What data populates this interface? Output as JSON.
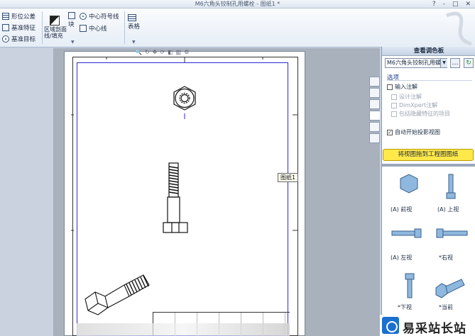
{
  "window": {
    "title": "M6六角头铰制孔用螺栓 - 图纸1 *",
    "buttons": [
      "?",
      "-",
      "□",
      "✕"
    ]
  },
  "ribbon": {
    "form_tolerance": "形位公差",
    "datum_feature": "基准特征",
    "datum_target": "基准目标",
    "area_hatch": "区域剖面线/填充",
    "block": "块",
    "centerline_mark": "中心符号线",
    "centerline": "中心线",
    "table": "表格"
  },
  "canvas": {
    "sheet_tooltip": "图纸1"
  },
  "task_pane": {
    "title": "查看调色板",
    "model_select": "M6六角头铰制孔用螺",
    "options_heading": "选项",
    "input_annotations": "输入注解",
    "design_annotations": "设计注解",
    "dimxpert_annotations": "DimXpert注解",
    "hidden_features": "包括隐藏特征的项目",
    "auto_projected": "自动开始投影视图",
    "drag_button": "将视图拖到工程图图纸",
    "views": [
      {
        "label": "(A) 前视"
      },
      {
        "label": "(A) 上视"
      },
      {
        "label": "(A) 左视"
      },
      {
        "label": "*右视"
      },
      {
        "label": "*下视"
      },
      {
        "label": "*当前"
      }
    ]
  },
  "watermark": {
    "text": "易采站长站"
  },
  "colors": {
    "drag_button": "#ffe84a",
    "view_zone_border": "#2a2ad8",
    "ribbon_bg": "#e6edf6"
  }
}
